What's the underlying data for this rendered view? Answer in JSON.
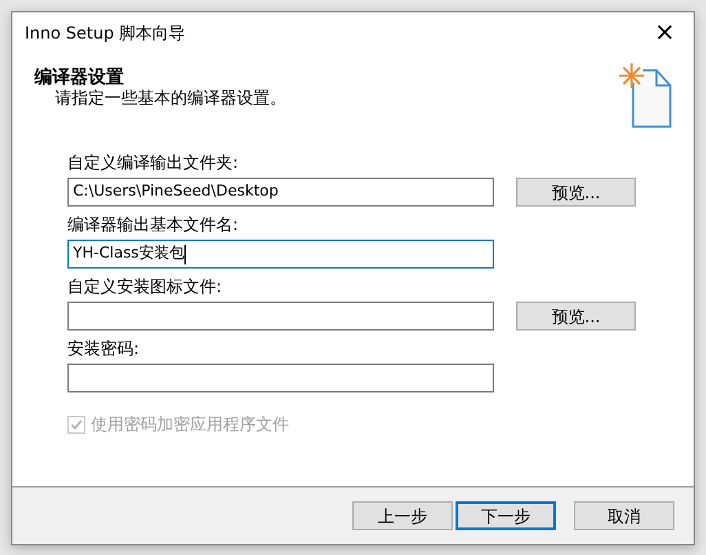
{
  "window": {
    "title": "Inno Setup 脚本向导",
    "close": "×"
  },
  "header": {
    "title": "编译器设置",
    "subtitle": "请指定一些基本的编译器设置。"
  },
  "fields": [
    {
      "label": "自定义编译输出文件夹:",
      "value": "C:\\Users\\PineSeed\\Desktop",
      "focused": false,
      "browse": "预览..."
    },
    {
      "label": "编译器输出基本文件名:",
      "value": "YH-Class安装包",
      "focused": true
    },
    {
      "label": "自定义安装图标文件:",
      "focused": false,
      "browse": "预览..."
    },
    {
      "label": "安装密码:",
      "focused": false
    }
  ],
  "checkbox": {
    "label": "使用密码加密应用程序文件",
    "checked": true,
    "disabled": true
  },
  "buttons": [
    {
      "label": "上一步",
      "focused": false
    },
    {
      "label": "下一步",
      "focused": true
    },
    {
      "label": "取消",
      "focused": false
    }
  ]
}
